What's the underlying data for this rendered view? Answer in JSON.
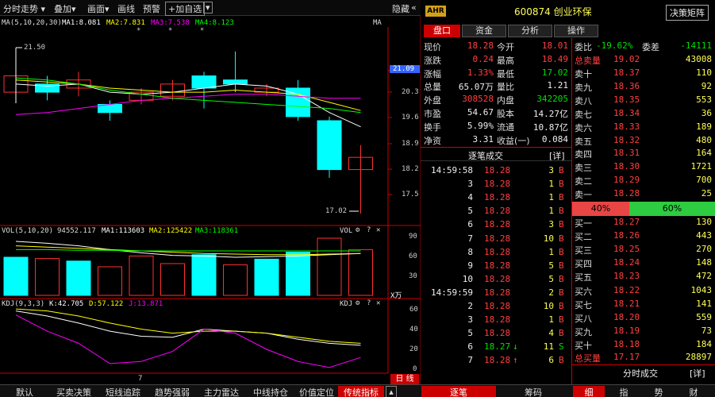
{
  "toolbar": {
    "timeshare": "分时走势",
    "overlay": "叠加",
    "draw_screen": "画面",
    "draw_line": "画线",
    "alert": "预警",
    "add_watch": "+加自选",
    "hide": "隐藏",
    "nav_left": "«",
    "nav_right": "»"
  },
  "ma_line": {
    "label": "MA(5,10,20,30)",
    "ma1": "MA1:8.081",
    "ma2": "MA2:7.831",
    "ma3": "MA3:7.538",
    "ma4": "MA4:8.123",
    "right": "MA"
  },
  "price_axis": [
    "21.09",
    "20.3",
    "19.6",
    "18.9",
    "18.2",
    "17.5"
  ],
  "price_marks": {
    "high": "21.50",
    "low": "17.02",
    "star": "*"
  },
  "vol_line": {
    "label": "VOL(5,10,20)",
    "v": "94552.117",
    "ma1": "MA1:113603",
    "ma2": "MA2:125422",
    "ma3": "MA3:118361",
    "right": "VOL"
  },
  "vol_axis": [
    "90",
    "60",
    "30"
  ],
  "vol_unit": "X万",
  "kdj_line": {
    "label": "KDJ(9,3,3)",
    "k": "K:42.705",
    "d": "D:57.122",
    "j": "J:13.871",
    "right": "KDJ"
  },
  "kdj_axis": [
    "60",
    "40",
    "20",
    "0"
  ],
  "x_label": "7",
  "period": {
    "day": "日",
    "line": "线"
  },
  "tool_icons": {
    "gear": "⚙",
    "help": "?",
    "close": "✕"
  },
  "colors": {
    "up": "#ff3030",
    "down": "#00ffff",
    "ma1": "#ffffff",
    "ma2": "#ffff00",
    "ma3": "#ff00ff",
    "ma4": "#00ff00",
    "kdj_k": "#ffffff",
    "kdj_d": "#ffff00",
    "kdj_j": "#ff00ff"
  },
  "chart_data": [
    {
      "type": "candlestick",
      "x": [
        "1",
        "2",
        "3",
        "4",
        "5",
        "6",
        "7",
        "8",
        "9",
        "10",
        "11",
        "12"
      ],
      "ohlc": [
        [
          20.0,
          20.4,
          19.9,
          20.5
        ],
        [
          20.2,
          20.0,
          19.8,
          20.4
        ],
        [
          20.1,
          20.3,
          19.9,
          20.5
        ],
        [
          19.7,
          19.5,
          19.3,
          19.8
        ],
        [
          19.8,
          20.0,
          19.7,
          20.1
        ],
        [
          19.9,
          20.2,
          19.8,
          20.3
        ],
        [
          20.4,
          20.1,
          19.6,
          20.5
        ],
        [
          20.3,
          20.2,
          20.0,
          21.0
        ],
        [
          20.0,
          20.1,
          19.9,
          20.2
        ],
        [
          20.1,
          19.4,
          19.3,
          20.3
        ],
        [
          19.3,
          18.1,
          17.9,
          19.4
        ],
        [
          18.1,
          18.4,
          17.02,
          18.7
        ]
      ],
      "ma_series": [
        {
          "name": "MA1",
          "values": [
            20.2,
            20.15,
            20.2,
            20.0,
            19.95,
            20.0,
            20.1,
            20.2,
            20.15,
            19.95,
            19.5,
            19.15
          ]
        },
        {
          "name": "MA2",
          "values": [
            20.3,
            20.25,
            20.2,
            20.1,
            20.05,
            20.0,
            20.0,
            20.05,
            20.0,
            19.95,
            19.75,
            19.55
          ]
        },
        {
          "name": "MA3",
          "values": [
            19.45,
            19.5,
            19.6,
            19.7,
            19.8,
            19.85,
            19.9,
            19.95,
            19.95,
            19.9,
            19.85,
            19.85
          ]
        },
        {
          "name": "MA4",
          "values": [
            20.35,
            20.3,
            20.2,
            20.05,
            19.95,
            19.85,
            19.8,
            19.75,
            19.7,
            19.65,
            19.6,
            19.5
          ]
        }
      ],
      "ylim": [
        17.0,
        21.6
      ]
    },
    {
      "type": "bar",
      "x": [
        "1",
        "2",
        "3",
        "4",
        "5",
        "6",
        "7",
        "8",
        "9",
        "10",
        "11",
        "12"
      ],
      "values": [
        60,
        58,
        54,
        45,
        62,
        50,
        64,
        48,
        57,
        68,
        90,
        72
      ],
      "up": [
        false,
        true,
        false,
        true,
        true,
        true,
        false,
        true,
        false,
        false,
        true,
        true
      ],
      "ma_series": [
        {
          "name": "MA1",
          "values": [
            85,
            82,
            78,
            72,
            67,
            63,
            62,
            60,
            61,
            62,
            64,
            66
          ]
        },
        {
          "name": "MA2",
          "values": [
            78,
            76,
            74,
            72,
            70,
            68,
            66,
            65,
            64,
            64,
            65,
            66
          ]
        },
        {
          "name": "MA3",
          "values": [
            72,
            72,
            71,
            71,
            70,
            70,
            70,
            70,
            70,
            70,
            70,
            70
          ]
        }
      ],
      "ylim": [
        0,
        100
      ]
    },
    {
      "type": "line",
      "x": [
        "1",
        "2",
        "3",
        "4",
        "5",
        "6",
        "7",
        "8",
        "9",
        "10",
        "11",
        "12"
      ],
      "series": [
        {
          "name": "K",
          "values": [
            60,
            55,
            48,
            40,
            35,
            34,
            42,
            40,
            38,
            32,
            28,
            26
          ]
        },
        {
          "name": "D",
          "values": [
            62,
            60,
            55,
            48,
            42,
            38,
            40,
            40,
            38,
            34,
            30,
            28
          ]
        },
        {
          "name": "J",
          "values": [
            56,
            40,
            28,
            8,
            10,
            20,
            42,
            38,
            22,
            10,
            4,
            14
          ]
        }
      ],
      "ylim": [
        0,
        66
      ]
    }
  ],
  "stock": {
    "tag": "AHR",
    "code": "600874",
    "name": "创业环保",
    "decision": "决策矩阵"
  },
  "tabs": [
    "盘口",
    "资金",
    "分析",
    "操作"
  ],
  "quote": [
    [
      "现价",
      "18.28",
      "今开",
      "18.01"
    ],
    [
      "涨跌",
      "0.24",
      "最高",
      "18.49"
    ],
    [
      "涨幅",
      "1.33%",
      "最低",
      "17.02"
    ],
    [
      "总量",
      "65.07万",
      "量比",
      "1.21"
    ],
    [
      "外盘",
      "308528",
      "内盘",
      "342205"
    ],
    [
      "市盈",
      "54.67",
      "股本",
      "14.27亿"
    ],
    [
      "换手",
      "5.99%",
      "流通",
      "10.87亿"
    ],
    [
      "净资",
      "3.31",
      "收益(一)",
      "0.084"
    ]
  ],
  "trade_title": "逐笔成交",
  "detail_btn": "[详]",
  "trades": [
    [
      "14:59:58",
      "18.28",
      "3",
      "B"
    ],
    [
      "3",
      "18.28",
      "1",
      "B"
    ],
    [
      "4",
      "18.28",
      "1",
      "B"
    ],
    [
      "5",
      "18.28",
      "1",
      "B"
    ],
    [
      "6",
      "18.28",
      "3",
      "B"
    ],
    [
      "7",
      "18.28",
      "10",
      "B"
    ],
    [
      "8",
      "18.28",
      "1",
      "B"
    ],
    [
      "9",
      "18.28",
      "5",
      "B"
    ],
    [
      "10",
      "18.28",
      "5",
      "B"
    ],
    [
      "14:59:59",
      "18.28",
      "2",
      "B"
    ],
    [
      "2",
      "18.28",
      "10",
      "B"
    ],
    [
      "3",
      "18.28",
      "1",
      "B"
    ],
    [
      "5",
      "18.28",
      "4",
      "B"
    ],
    [
      "6",
      "18.27",
      "11",
      "S"
    ],
    [
      "7",
      "18.28",
      "6",
      "B"
    ]
  ],
  "trade_arrows": {
    "down": "↓",
    "up": "↑"
  },
  "book_head": {
    "wb_label": "委比",
    "wb": "-19.62%",
    "wc_label": "委差",
    "wc": "-14111",
    "sell_total_label": "总卖量",
    "sell_total_price": "19.02",
    "sell_total_vol": "43008"
  },
  "asks": [
    [
      "卖十",
      "18.37",
      "110"
    ],
    [
      "卖九",
      "18.36",
      "92"
    ],
    [
      "卖八",
      "18.35",
      "553"
    ],
    [
      "卖七",
      "18.34",
      "36"
    ],
    [
      "卖六",
      "18.33",
      "189"
    ],
    [
      "卖五",
      "18.32",
      "480"
    ],
    [
      "卖四",
      "18.31",
      "164"
    ],
    [
      "卖三",
      "18.30",
      "1721"
    ],
    [
      "卖二",
      "18.29",
      "700"
    ],
    [
      "卖一",
      "18.28",
      "25"
    ]
  ],
  "ratio": {
    "sell": "40%",
    "buy": "60%",
    "sell_frac": 0.4
  },
  "bids": [
    [
      "买一",
      "18.27",
      "130"
    ],
    [
      "买二",
      "18.26",
      "443"
    ],
    [
      "买三",
      "18.25",
      "270"
    ],
    [
      "买四",
      "18.24",
      "148"
    ],
    [
      "买五",
      "18.23",
      "472"
    ],
    [
      "买六",
      "18.22",
      "1043"
    ],
    [
      "买七",
      "18.21",
      "141"
    ],
    [
      "买八",
      "18.20",
      "559"
    ],
    [
      "买九",
      "18.19",
      "73"
    ],
    [
      "买十",
      "18.18",
      "184"
    ]
  ],
  "buy_total": {
    "label": "总买量",
    "price": "17.17",
    "vol": "28897"
  },
  "minute_trade": "分时成交",
  "bottom_tabs": [
    "默认",
    "买卖决策",
    "短线追踪",
    "趋势强弱",
    "主力雷达",
    "中线持仓",
    "价值定位",
    "传统指标"
  ],
  "bottom_right": [
    "逐笔",
    "筹码"
  ],
  "bottom_far": [
    "细",
    "指",
    "势",
    "财"
  ]
}
